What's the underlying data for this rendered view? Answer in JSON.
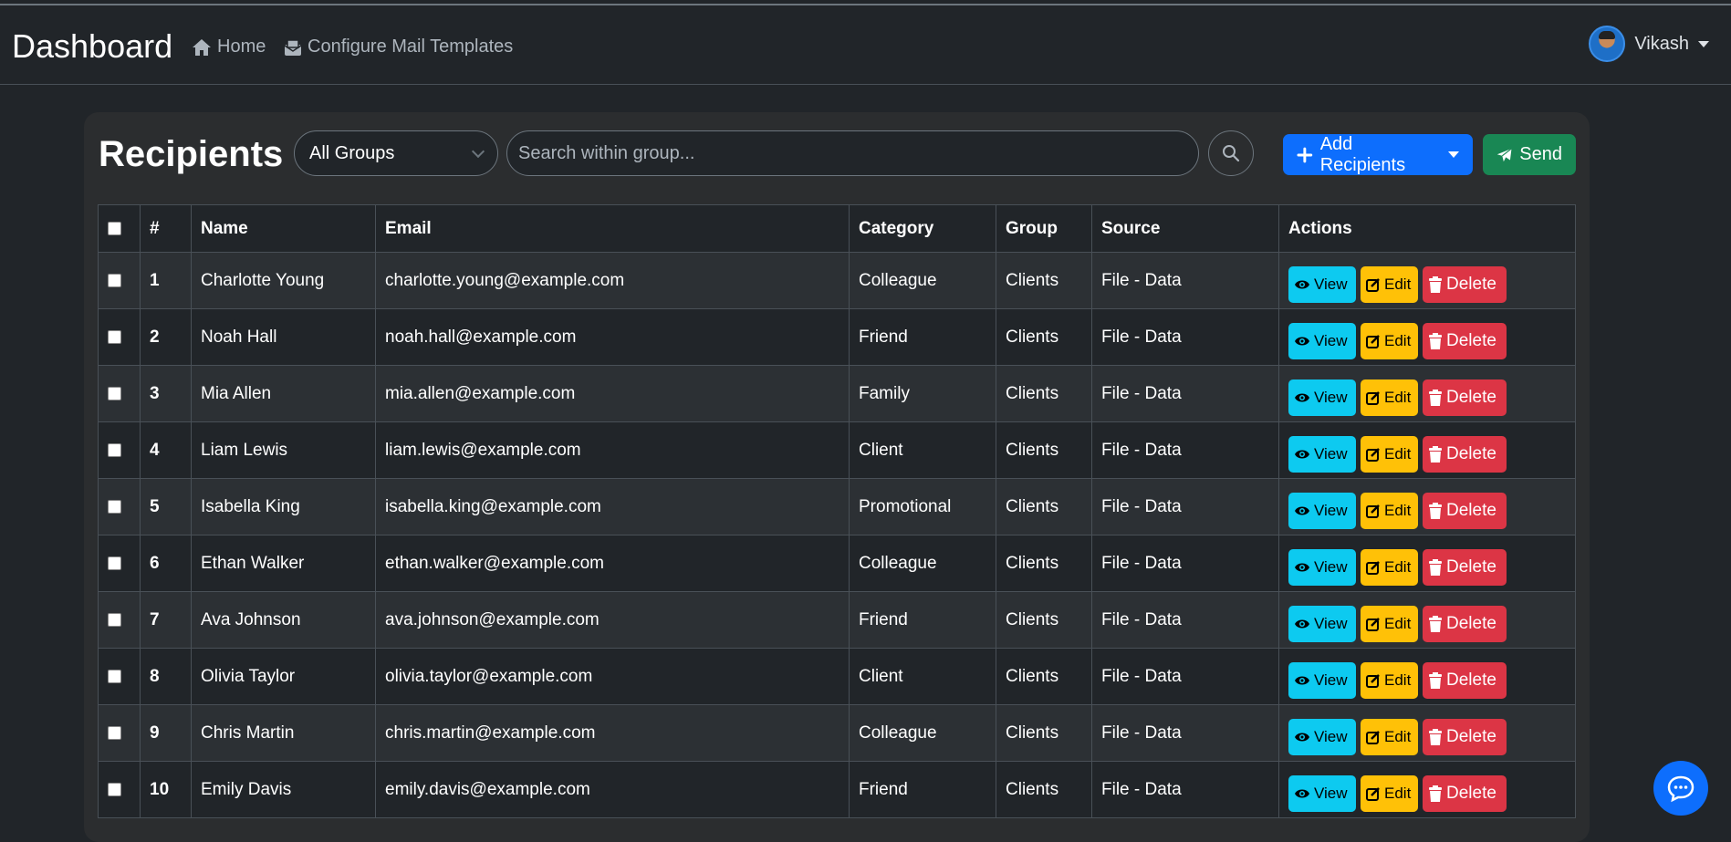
{
  "navbar": {
    "brand": "Dashboard",
    "links": [
      {
        "label": "Home",
        "icon": "home-icon"
      },
      {
        "label": "Configure Mail Templates",
        "icon": "mail-box-icon"
      }
    ],
    "user": {
      "name": "Vikash"
    }
  },
  "card": {
    "title": "Recipients",
    "group_select": {
      "value": "All Groups"
    },
    "search": {
      "placeholder": "Search within group..."
    },
    "add_button": "Add Recipients",
    "send_button": "Send"
  },
  "table": {
    "headers": [
      "#",
      "Name",
      "Email",
      "Category",
      "Group",
      "Source",
      "Actions"
    ],
    "rows": [
      {
        "num": "1",
        "name": "Charlotte Young",
        "email": "charlotte.young@example.com",
        "category": "Colleague",
        "group": "Clients",
        "source": "File - Data"
      },
      {
        "num": "2",
        "name": "Noah Hall",
        "email": "noah.hall@example.com",
        "category": "Friend",
        "group": "Clients",
        "source": "File - Data"
      },
      {
        "num": "3",
        "name": "Mia Allen",
        "email": "mia.allen@example.com",
        "category": "Family",
        "group": "Clients",
        "source": "File - Data"
      },
      {
        "num": "4",
        "name": "Liam Lewis",
        "email": "liam.lewis@example.com",
        "category": "Client",
        "group": "Clients",
        "source": "File - Data"
      },
      {
        "num": "5",
        "name": "Isabella King",
        "email": "isabella.king@example.com",
        "category": "Promotional",
        "group": "Clients",
        "source": "File - Data"
      },
      {
        "num": "6",
        "name": "Ethan Walker",
        "email": "ethan.walker@example.com",
        "category": "Colleague",
        "group": "Clients",
        "source": "File - Data"
      },
      {
        "num": "7",
        "name": "Ava Johnson",
        "email": "ava.johnson@example.com",
        "category": "Friend",
        "group": "Clients",
        "source": "File - Data"
      },
      {
        "num": "8",
        "name": "Olivia Taylor",
        "email": "olivia.taylor@example.com",
        "category": "Client",
        "group": "Clients",
        "source": "File - Data"
      },
      {
        "num": "9",
        "name": "Chris Martin",
        "email": "chris.martin@example.com",
        "category": "Colleague",
        "group": "Clients",
        "source": "File - Data"
      },
      {
        "num": "10",
        "name": "Emily Davis",
        "email": "emily.davis@example.com",
        "category": "Friend",
        "group": "Clients",
        "source": "File - Data"
      }
    ],
    "actions": {
      "view": "View",
      "edit": "Edit",
      "delete": "Delete"
    }
  },
  "colors": {
    "background": "#212529",
    "card": "#2b2d2f",
    "primary": "#0d6efd",
    "success": "#198754",
    "info": "#0dcaf0",
    "warning": "#ffc107",
    "danger": "#dc3545"
  }
}
